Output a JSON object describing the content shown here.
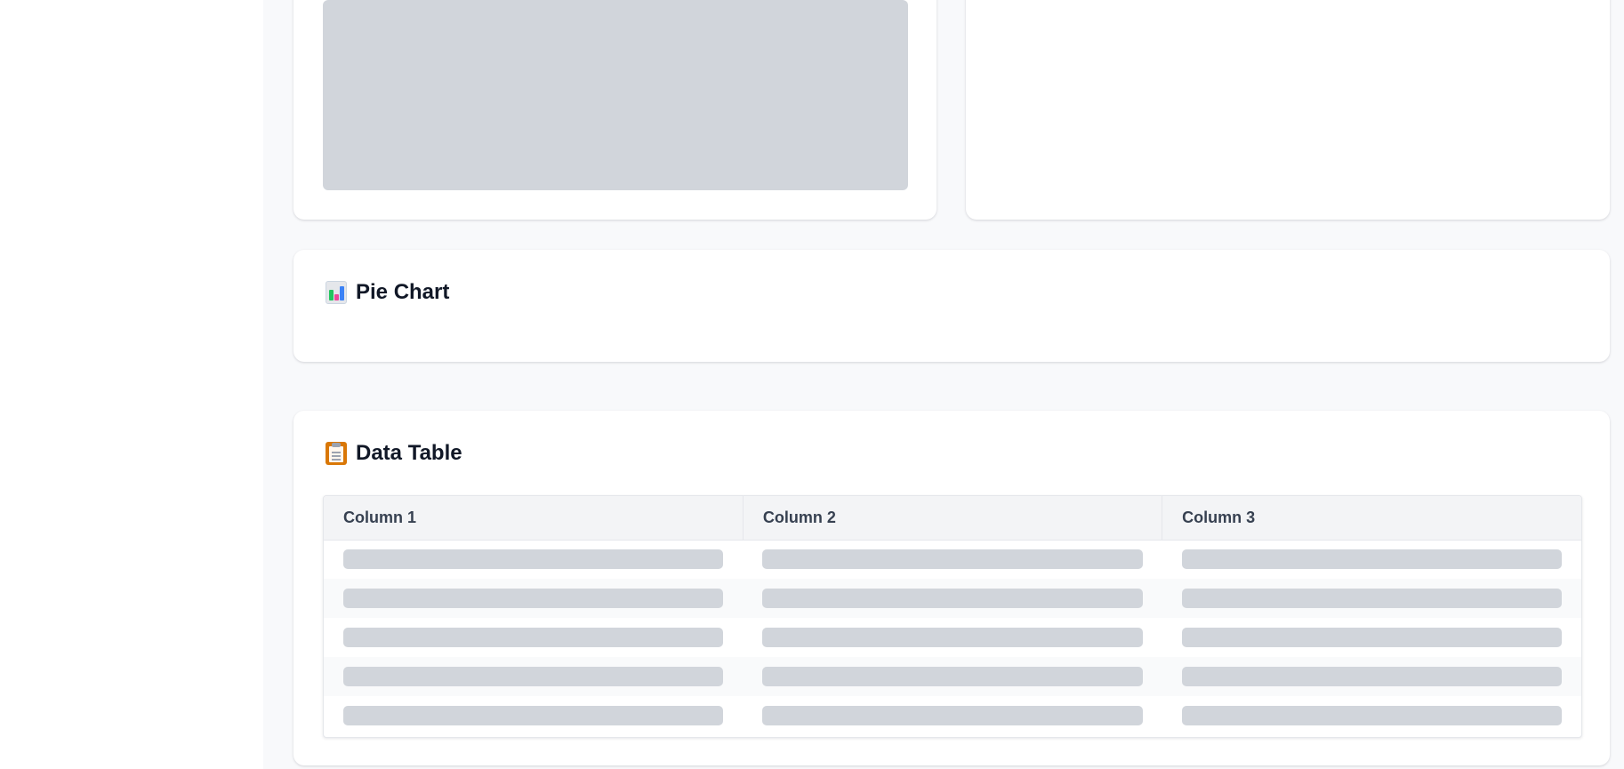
{
  "sections": {
    "pie_chart": {
      "title": "Pie Chart",
      "icon": "bar-chart-icon"
    },
    "data_table": {
      "title": "Data Table",
      "icon": "clipboard-icon",
      "columns": [
        "Column 1",
        "Column 2",
        "Column 3"
      ],
      "row_count": 5,
      "state": "loading"
    }
  },
  "colors": {
    "background": "#f8f9fb",
    "card": "#ffffff",
    "skeleton": "#d1d5db",
    "header_bg": "#f3f4f6"
  }
}
